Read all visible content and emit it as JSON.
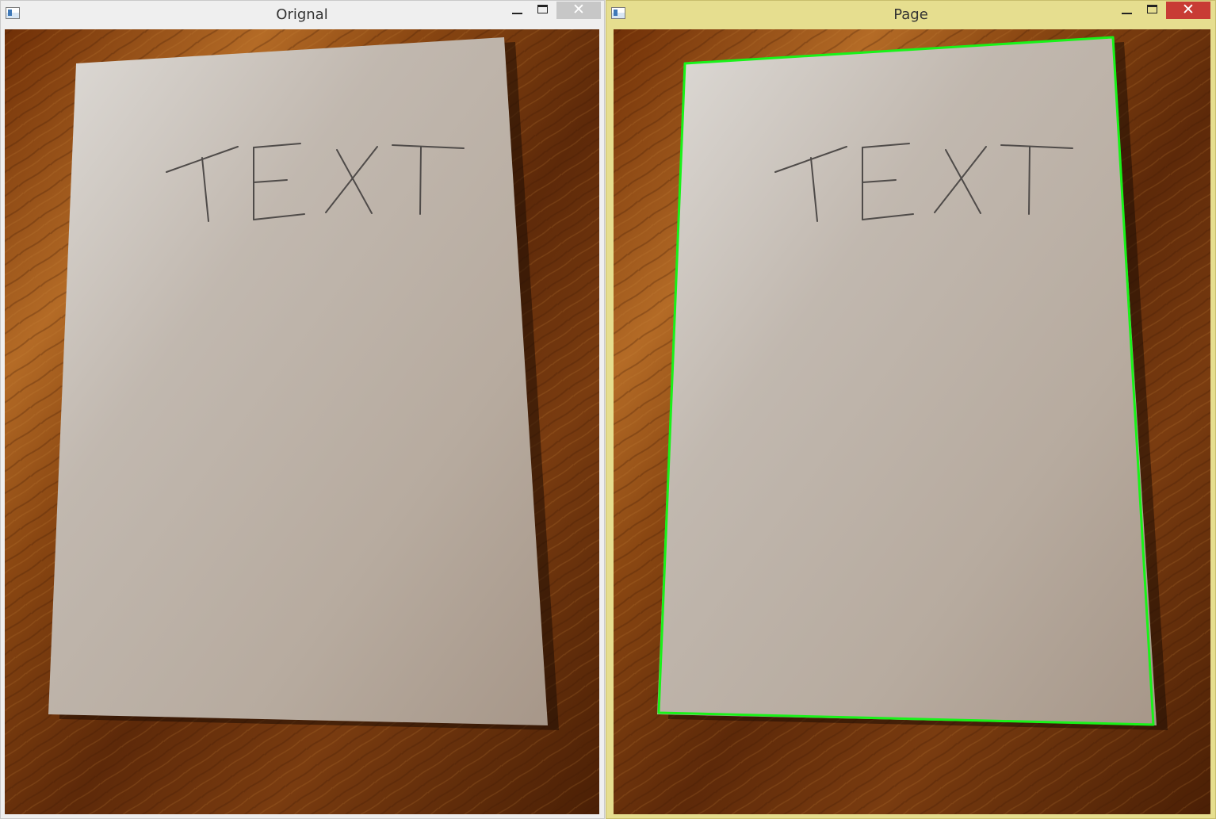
{
  "windows": {
    "left": {
      "title": "Orignal"
    },
    "right": {
      "title": "Page",
      "outline_color": "#19f219"
    }
  },
  "page": {
    "handwritten_text": "TEXT"
  },
  "icons": {
    "app": "app-window-icon",
    "minimize": "minimize-icon",
    "maximize": "maximize-icon",
    "close": "close-icon"
  },
  "colors": {
    "table_wood": "#7a3c10",
    "paper": "#bdb2a7",
    "inactive_close_button": "#c7c7c7",
    "active_close_button": "#c83b35",
    "active_titlebar": "#e6de8f"
  }
}
